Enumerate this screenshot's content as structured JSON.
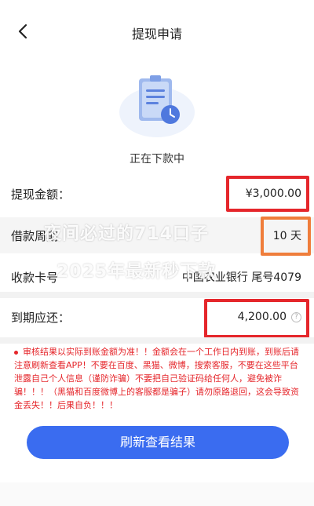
{
  "nav": {
    "title": "提现申请",
    "back_icon": "chevron-left-icon"
  },
  "status": {
    "icon": "document-clock-icon",
    "text": "正在下款中"
  },
  "details": {
    "amount": {
      "label": "提现金额：",
      "value": "¥3,000.00"
    },
    "term": {
      "label": "借款周期",
      "value": "10 天"
    },
    "card": {
      "label": "收款卡号",
      "value": "中国农业银行 尾号4079"
    },
    "due": {
      "label": "到期应还：",
      "value": "4,200.00",
      "help_icon": "?"
    }
  },
  "watermark": {
    "line1": "夜间必过的714口子",
    "line2": "2025年最新秒下款"
  },
  "notice": {
    "text": "审核结果以实际到账金额为准！！金额会在一个工作日内到账，到账后请注意刷新查看APP！不要在百度、黑猫、微博，搜索客服，不要在这些平台泄露自己个人信息（谨防诈骗）不要把自己验证码给任何人，避免被诈骗！！！（黑猫和百度微博上的客服都是骗子）请勿原路退回，这会导致资金丢失！！后果自负！！！"
  },
  "actions": {
    "refresh_label": "刷新查看结果"
  },
  "colors": {
    "primary": "#3a6cf0",
    "highlight_red": "#e5262b",
    "highlight_orange": "#ef7d3b",
    "notice_red": "#e5262b"
  }
}
